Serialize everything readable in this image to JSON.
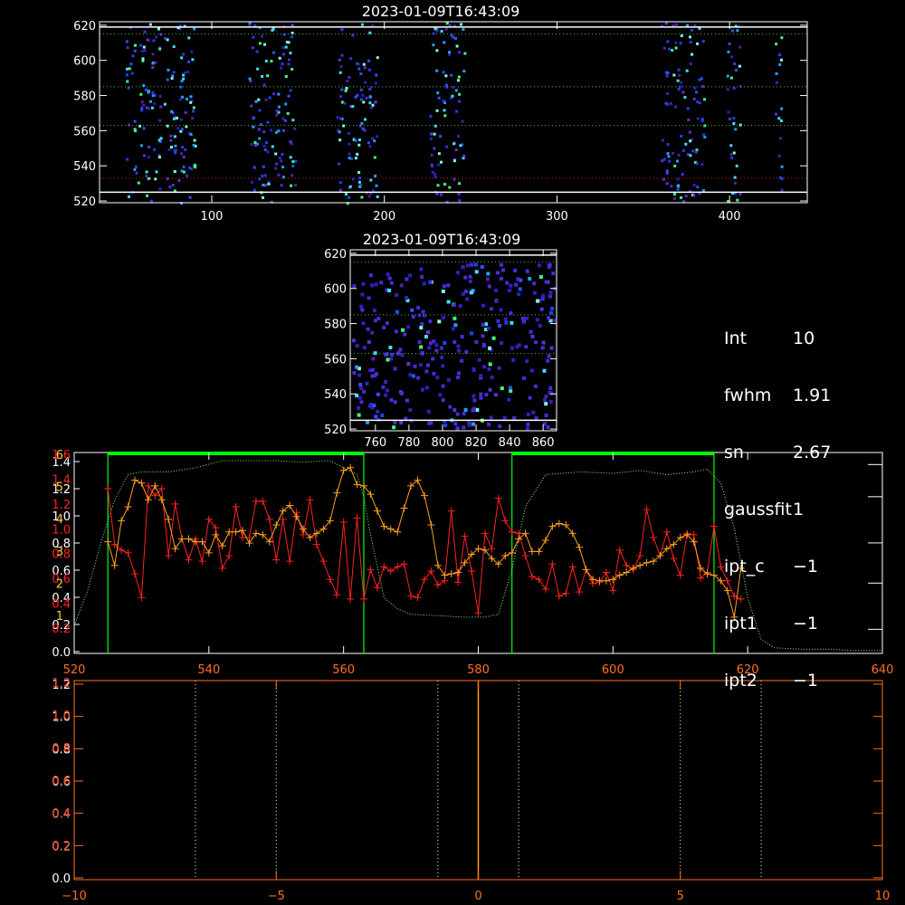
{
  "image_title": "2023-01-09T16:43:09",
  "zoom_title": "2023-01-09T16:43:09",
  "info_panel": [
    {
      "key": "Int",
      "value": "10"
    },
    {
      "key": "fwhm",
      "value": "1.91"
    },
    {
      "key": "sn",
      "value": "2.67"
    },
    {
      "key": "gaussfit",
      "value": "1"
    },
    {
      "key": "ipt_c",
      "value": "−1"
    },
    {
      "key": "ipt1",
      "value": "−1"
    },
    {
      "key": "ipt2",
      "value": "−1"
    }
  ],
  "colors": {
    "axes": "#ffffff",
    "profile_red": "#ff2020",
    "profile_orange": "#ffa020",
    "envelope": "#80ff80",
    "window_lines": "#00ff00",
    "window_bar": "#00ff00",
    "lower_axes": "#ff7020",
    "lower_vline": "#ffa020",
    "dotted_lines": "#ffff80"
  },
  "chart_data": [
    {
      "type": "heatmap",
      "title": "2023-01-09T16:43:09",
      "xlim": [
        35,
        445
      ],
      "ylim": [
        519,
        622
      ],
      "x_ticks": [
        "100",
        "200",
        "300",
        "400"
      ],
      "y_ticks": [
        "520",
        "540",
        "560",
        "580",
        "600",
        "620"
      ],
      "column_bands": [
        [
          50,
          90
        ],
        [
          121,
          148
        ],
        [
          172,
          196
        ],
        [
          226,
          246
        ],
        [
          360,
          385
        ],
        [
          398,
          406
        ],
        [
          426,
          430
        ]
      ],
      "horizontal_lines": {
        "white": [
          525,
          619
        ],
        "green_dotted": [
          563,
          585,
          615
        ],
        "red_dotted": [
          533
        ]
      }
    },
    {
      "type": "heatmap",
      "title": "2023-01-09T16:43:09",
      "xlim": [
        745,
        868
      ],
      "ylim": [
        519,
        622
      ],
      "x_ticks": [
        "760",
        "780",
        "800",
        "820",
        "840",
        "860"
      ],
      "y_ticks": [
        "520",
        "540",
        "560",
        "580",
        "600",
        "620"
      ],
      "horizontal_lines": {
        "white": [
          525,
          619
        ],
        "green_dotted": [
          563,
          585,
          615
        ]
      }
    },
    {
      "type": "line",
      "xlim": [
        520,
        640
      ],
      "x_ticks": [
        "520",
        "540",
        "560",
        "580",
        "600",
        "620",
        "640"
      ],
      "left_ticks_white": [
        "0.0",
        "0.2",
        "0.4",
        "0.6",
        "0.8",
        "1.0",
        "1.2",
        "1.4"
      ],
      "left_ticks_red": [
        "0.2",
        "0.4",
        "0.6",
        "0.8",
        "1.0",
        "1.2",
        "1.4",
        "1.6"
      ],
      "left_ticks_orange": [
        "1",
        "2",
        "3",
        "4",
        "5",
        "6"
      ],
      "ylim": [
        0,
        1.4
      ],
      "windows": [
        [
          525,
          563
        ],
        [
          585,
          615
        ]
      ],
      "series": [
        {
          "x": [
            525,
            526,
            527,
            528,
            529,
            530,
            531,
            532,
            533,
            534,
            535,
            536,
            537,
            538,
            539,
            540,
            541,
            542,
            543,
            544,
            545,
            546,
            547,
            548,
            549,
            550,
            551,
            552,
            553,
            554,
            555,
            556,
            557,
            558,
            559,
            560,
            561,
            562,
            563,
            564,
            565,
            566,
            567,
            568,
            569,
            570,
            571,
            572,
            573,
            574,
            575,
            576,
            577,
            578,
            579,
            580,
            581,
            582,
            583,
            584,
            585,
            586,
            587,
            588,
            589,
            590,
            591,
            592,
            593,
            594,
            595,
            596,
            597,
            598,
            599,
            600,
            601,
            602,
            603,
            604,
            605,
            606,
            607,
            608,
            609,
            610,
            611,
            612,
            613,
            614,
            615,
            616,
            617,
            618,
            619
          ],
          "values": [
            1.18,
            0.78,
            0.74,
            0.72,
            0.57,
            0.4,
            1.2,
            1.13,
            1.18,
            0.7,
            1.07,
            0.82,
            0.67,
            0.82,
            0.66,
            0.96,
            0.9,
            0.61,
            0.7,
            1.05,
            0.83,
            0.83,
            1.09,
            1.09,
            0.96,
            0.67,
            0.96,
            0.66,
            1.01,
            0.85,
            1.1,
            0.78,
            0.66,
            0.53,
            0.42,
            0.94,
            0.39,
            0.97,
            0.39,
            0.6,
            0.47,
            0.62,
            0.59,
            0.62,
            0.64,
            0.41,
            0.4,
            0.53,
            0.59,
            0.49,
            0.52,
            1.02,
            0.51,
            0.84,
            0.59,
            0.29,
            0.86,
            0.75,
            1.11,
            0.95,
            0.87,
            0.86,
            0.7,
            0.55,
            0.53,
            0.46,
            0.64,
            0.41,
            0.43,
            0.62,
            0.44,
            0.6,
            0.5,
            0.51,
            0.58,
            0.45,
            0.74,
            0.63,
            0.6,
            0.7,
            1.03,
            0.83,
            0.7,
            0.87,
            0.68,
            0.56,
            0.86,
            0.85,
            0.54,
            0.58,
            0.91,
            0.62,
            0.52,
            0.41,
            0.39
          ]
        },
        {
          "x": [
            525,
            526,
            527,
            528,
            529,
            530,
            531,
            532,
            533,
            534,
            535,
            536,
            537,
            538,
            539,
            540,
            541,
            542,
            543,
            544,
            545,
            546,
            547,
            548,
            549,
            550,
            551,
            552,
            553,
            554,
            555,
            556,
            557,
            558,
            559,
            560,
            561,
            562,
            563,
            564,
            565,
            566,
            567,
            568,
            569,
            570,
            571,
            572,
            573,
            574,
            575,
            576,
            577,
            578,
            579,
            580,
            581,
            582,
            583,
            584,
            585,
            586,
            587,
            588,
            589,
            590,
            591,
            592,
            593,
            594,
            595,
            596,
            597,
            598,
            599,
            600,
            601,
            602,
            603,
            604,
            605,
            606,
            607,
            608,
            609,
            610,
            611,
            612,
            613,
            614,
            615,
            616,
            617,
            618,
            619
          ],
          "values": [
            0.8,
            0.63,
            0.95,
            1.05,
            1.24,
            1.22,
            1.1,
            1.2,
            1.1,
            0.96,
            0.75,
            0.82,
            0.82,
            0.8,
            0.8,
            0.72,
            0.85,
            0.77,
            0.87,
            0.87,
            0.88,
            0.79,
            0.86,
            0.85,
            0.8,
            0.92,
            1.02,
            1.06,
            0.98,
            0.89,
            0.83,
            0.86,
            0.89,
            0.95,
            1.15,
            1.31,
            1.33,
            1.21,
            1.2,
            1.14,
            1.02,
            0.91,
            0.89,
            0.87,
            1.04,
            1.2,
            1.24,
            1.13,
            0.92,
            0.63,
            0.56,
            0.57,
            0.58,
            0.65,
            0.71,
            0.75,
            0.74,
            0.68,
            0.64,
            0.7,
            0.72,
            0.82,
            0.86,
            0.73,
            0.73,
            0.81,
            0.91,
            0.93,
            0.92,
            0.86,
            0.76,
            0.6,
            0.53,
            0.52,
            0.52,
            0.53,
            0.56,
            0.58,
            0.61,
            0.63,
            0.65,
            0.66,
            0.7,
            0.75,
            0.78,
            0.83,
            0.85,
            0.8,
            0.61,
            0.57,
            0.56,
            0.52,
            0.45,
            0.26,
            0.61
          ]
        },
        {
          "x": [
            520,
            522,
            524,
            526,
            528,
            530,
            534,
            538,
            542,
            546,
            550,
            554,
            558,
            560,
            562,
            563,
            564,
            566,
            568,
            570,
            574,
            578,
            581,
            583,
            585,
            587,
            590,
            595,
            600,
            604,
            608,
            612,
            614,
            616,
            618,
            620,
            622,
            624,
            628,
            632,
            636,
            640
          ],
          "values": [
            0.2,
            0.45,
            0.8,
            1.1,
            1.28,
            1.3,
            1.3,
            1.33,
            1.38,
            1.38,
            1.38,
            1.37,
            1.38,
            1.33,
            1.28,
            1.12,
            0.85,
            0.4,
            0.32,
            0.28,
            0.27,
            0.26,
            0.26,
            0.28,
            0.6,
            1.05,
            1.28,
            1.3,
            1.29,
            1.31,
            1.28,
            1.3,
            1.32,
            1.22,
            0.9,
            0.4,
            0.1,
            0.04,
            0.03,
            0.03,
            0.02,
            0.02
          ]
        }
      ]
    },
    {
      "type": "line",
      "xlim": [
        -10,
        10
      ],
      "ylim": [
        0,
        1.2
      ],
      "x_ticks": [
        "−10",
        "−5",
        "0",
        "5",
        "10"
      ],
      "y_ticks_white": [
        "0.0",
        "0.2",
        "0.4",
        "0.6",
        "0.8",
        "1.0",
        "1.2"
      ],
      "y_ticks_red": [
        "0.2",
        "0.4",
        "0.6",
        "0.8",
        "1.0",
        "1.2"
      ],
      "vertical_line_orange": 0,
      "dotted_vertical_lines": [
        -7,
        -5,
        -1,
        1,
        5,
        7
      ]
    }
  ]
}
